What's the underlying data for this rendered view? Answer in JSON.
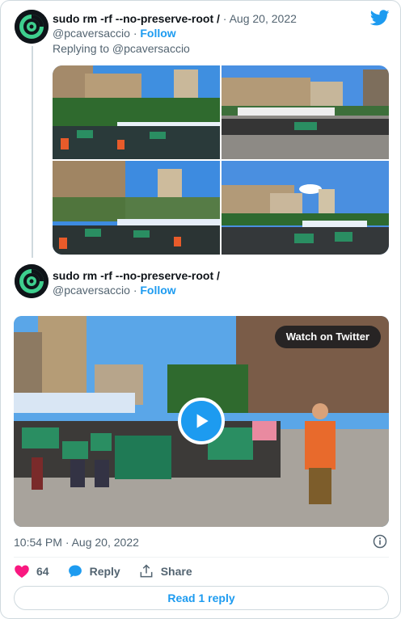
{
  "colors": {
    "accent": "#1d9bf0",
    "like": "#f91880",
    "text": "#0f1419",
    "muted": "#536471",
    "border": "#cfd9de"
  },
  "icons": [
    "twitter-bird-icon",
    "heart-icon",
    "reply-bubble-icon",
    "share-icon",
    "info-icon",
    "play-icon"
  ],
  "tweet1": {
    "display_name": "sudo rm -rf --no-preserve-root /",
    "separator": "·",
    "date": "Aug 20, 2022",
    "handle": "@pcaversaccio",
    "follow": "Follow",
    "replying_to": "Replying to @pcaversaccio"
  },
  "tweet2": {
    "display_name": "sudo rm -rf --no-preserve-root /",
    "handle": "@pcaversaccio",
    "follow": "Follow",
    "watch_label": "Watch on Twitter",
    "video_banner_1": "FREE ALEX PERTSEV",
    "video_banner_2": "FREE ALEX PERTSEV",
    "timestamp": "10:54 PM · Aug 20, 2022",
    "likes": "64",
    "reply_label": "Reply",
    "share_label": "Share",
    "read_replies": "Read 1 reply"
  }
}
